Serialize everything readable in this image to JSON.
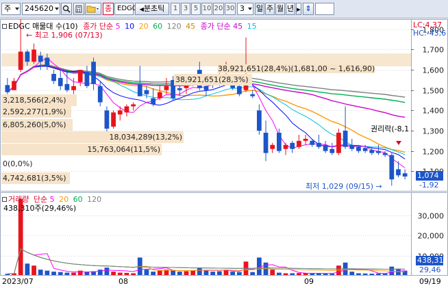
{
  "toolbar": {
    "market_label": "주",
    "code_value": "245620",
    "indicator_label": "EDGC",
    "period_label": "분초틱",
    "period_numbers": [
      "1",
      "3",
      "5",
      "10",
      "20",
      "30"
    ],
    "count_value": "3",
    "day_label": "일",
    "week_label": "주",
    "month_label": "월",
    "year_label": "년"
  },
  "colors": {
    "up": "#e8141c",
    "down": "#1e55c8",
    "ma5": "#ff00ff",
    "ma10": "#0000ff",
    "ma20": "#ff9900",
    "ma60": "#00b050",
    "ma120": "#808080",
    "ma45": "#cc00cc",
    "ma15": "#00c0e0"
  },
  "legend_main": {
    "stock": "EDGC 매물대 수(10)",
    "ma_group1_label": "종가 단순",
    "ma_group1_periods": [
      "5",
      "10",
      "20",
      "60",
      "120",
      "45"
    ],
    "ma_group2_label": "종가 단순",
    "ma_group2_periods": [
      "45",
      "15"
    ]
  },
  "legend_vol": {
    "label": "거래량",
    "ma_label": "단순",
    "periods": [
      "5",
      "20",
      "60",
      "120"
    ],
    "volume_note": "438,310주(29,46%)"
  },
  "price_axis": {
    "ticks": [
      "1,800",
      "1,700",
      "1,600",
      "1,500",
      "1,400",
      "1,300",
      "1,200",
      "1,100"
    ],
    "lc": "LC:4,37",
    "hc": "HC:-43,6",
    "current_price": "1,074",
    "current_change": "-1,92"
  },
  "vol_axis": {
    "ticks": [
      "30,000",
      "20,000",
      "10,000"
    ],
    "current_volume": "438,31",
    "current_change": "29,46"
  },
  "volume_profile": [
    {
      "label": "38,921,651(28,4%)(1,681,00 ~ 1,616,90)"
    },
    {
      "label": "38,921,651(28,3%)"
    },
    {
      "label": "3,218,566(2,4%)"
    },
    {
      "label": "2,592,277(1,9%)"
    },
    {
      "label": "6,805,260(5,0%)"
    },
    {
      "label": "18,034,289(13,2%)"
    },
    {
      "label": "15,763,064(11,5%)"
    },
    {
      "label": "0(0,0%)"
    },
    {
      "label": "4,742,681(3,5%)"
    }
  ],
  "annotations": {
    "high": "최고 1,906 (07/13)",
    "low": "최저 1,029 (09/15)",
    "rights": "권리락(-8,1"
  },
  "dates": [
    "2023/07",
    "08",
    "09",
    "09/19"
  ],
  "chart_data": {
    "type": "candlestick",
    "title": "",
    "ylim": [
      1000,
      1850
    ],
    "candles": [
      {
        "o": 1525,
        "h": 1560,
        "l": 1480,
        "c": 1490
      },
      {
        "o": 1500,
        "h": 1560,
        "l": 1500,
        "c": 1545
      },
      {
        "o": 1600,
        "h": 1906,
        "l": 1590,
        "c": 1690
      },
      {
        "o": 1690,
        "h": 1700,
        "l": 1620,
        "c": 1640
      },
      {
        "o": 1640,
        "h": 1730,
        "l": 1630,
        "c": 1700
      },
      {
        "o": 1670,
        "h": 1690,
        "l": 1600,
        "c": 1640
      },
      {
        "o": 1660,
        "h": 1680,
        "l": 1600,
        "c": 1620
      },
      {
        "o": 1580,
        "h": 1600,
        "l": 1530,
        "c": 1545
      },
      {
        "o": 1560,
        "h": 1600,
        "l": 1500,
        "c": 1520
      },
      {
        "o": 1530,
        "h": 1600,
        "l": 1490,
        "c": 1500
      },
      {
        "o": 1500,
        "h": 1560,
        "l": 1480,
        "c": 1520
      },
      {
        "o": 1540,
        "h": 1600,
        "l": 1520,
        "c": 1600
      },
      {
        "o": 1590,
        "h": 1620,
        "l": 1510,
        "c": 1520
      },
      {
        "o": 1640,
        "h": 1660,
        "l": 1500,
        "c": 1530
      },
      {
        "o": 1520,
        "h": 1540,
        "l": 1420,
        "c": 1440
      },
      {
        "o": 1400,
        "h": 1420,
        "l": 1290,
        "c": 1310
      },
      {
        "o": 1320,
        "h": 1400,
        "l": 1310,
        "c": 1390
      },
      {
        "o": 1380,
        "h": 1420,
        "l": 1350,
        "c": 1400
      },
      {
        "o": 1390,
        "h": 1430,
        "l": 1370,
        "c": 1420
      },
      {
        "o": 1420,
        "h": 1440,
        "l": 1400,
        "c": 1430
      },
      {
        "o": 1530,
        "h": 1620,
        "l": 1470,
        "c": 1470
      },
      {
        "o": 1500,
        "h": 1520,
        "l": 1460,
        "c": 1480
      },
      {
        "o": 1460,
        "h": 1510,
        "l": 1420,
        "c": 1430
      },
      {
        "o": 1460,
        "h": 1520,
        "l": 1450,
        "c": 1490
      },
      {
        "o": 1500,
        "h": 1560,
        "l": 1480,
        "c": 1520
      },
      {
        "o": 1550,
        "h": 1570,
        "l": 1450,
        "c": 1460
      },
      {
        "o": 1510,
        "h": 1540,
        "l": 1470,
        "c": 1500
      },
      {
        "o": 1510,
        "h": 1560,
        "l": 1480,
        "c": 1530
      },
      {
        "o": 1540,
        "h": 1580,
        "l": 1520,
        "c": 1555
      },
      {
        "o": 1600,
        "h": 1640,
        "l": 1500,
        "c": 1510
      },
      {
        "o": 1520,
        "h": 1580,
        "l": 1470,
        "c": 1500
      },
      {
        "o": 1540,
        "h": 1570,
        "l": 1510,
        "c": 1530
      },
      {
        "o": 1560,
        "h": 1600,
        "l": 1520,
        "c": 1545
      },
      {
        "o": 1590,
        "h": 1640,
        "l": 1560,
        "c": 1600
      },
      {
        "o": 1540,
        "h": 1570,
        "l": 1500,
        "c": 1510
      },
      {
        "o": 1520,
        "h": 1530,
        "l": 1470,
        "c": 1480
      },
      {
        "o": 1500,
        "h": 1760,
        "l": 1490,
        "c": 1560
      },
      {
        "o": 1480,
        "h": 1500,
        "l": 1460,
        "c": 1470
      },
      {
        "o": 1400,
        "h": 1430,
        "l": 1280,
        "c": 1300
      },
      {
        "o": 1290,
        "h": 1350,
        "l": 1150,
        "c": 1190
      },
      {
        "o": 1210,
        "h": 1240,
        "l": 1190,
        "c": 1230
      },
      {
        "o": 1290,
        "h": 1310,
        "l": 1190,
        "c": 1200
      },
      {
        "o": 1210,
        "h": 1240,
        "l": 1180,
        "c": 1230
      },
      {
        "o": 1240,
        "h": 1250,
        "l": 1190,
        "c": 1210
      },
      {
        "o": 1220,
        "h": 1280,
        "l": 1210,
        "c": 1250
      },
      {
        "o": 1250,
        "h": 1280,
        "l": 1230,
        "c": 1260
      },
      {
        "o": 1250,
        "h": 1260,
        "l": 1220,
        "c": 1230
      },
      {
        "o": 1240,
        "h": 1280,
        "l": 1210,
        "c": 1220
      },
      {
        "o": 1230,
        "h": 1250,
        "l": 1190,
        "c": 1200
      },
      {
        "o": 1210,
        "h": 1240,
        "l": 1180,
        "c": 1190
      },
      {
        "o": 1190,
        "h": 1310,
        "l": 1180,
        "c": 1290
      },
      {
        "o": 1300,
        "h": 1420,
        "l": 1210,
        "c": 1220
      },
      {
        "o": 1230,
        "h": 1260,
        "l": 1200,
        "c": 1210
      },
      {
        "o": 1220,
        "h": 1230,
        "l": 1190,
        "c": 1200
      },
      {
        "o": 1215,
        "h": 1230,
        "l": 1190,
        "c": 1200
      },
      {
        "o": 1205,
        "h": 1220,
        "l": 1180,
        "c": 1190
      },
      {
        "o": 1200,
        "h": 1230,
        "l": 1180,
        "c": 1190
      },
      {
        "o": 1190,
        "h": 1200,
        "l": 1170,
        "c": 1180
      },
      {
        "o": 1180,
        "h": 1190,
        "l": 1029,
        "c": 1060
      },
      {
        "o": 1110,
        "h": 1150,
        "l": 1070,
        "c": 1080
      },
      {
        "o": 1090,
        "h": 1110,
        "l": 1060,
        "c": 1074
      }
    ],
    "volumes": [
      900,
      1200,
      38000,
      6000,
      5000,
      3000,
      2500,
      2000,
      1800,
      1500,
      1500,
      2500,
      2000,
      2200,
      3000,
      4000,
      2000,
      1500,
      1400,
      1200,
      9000,
      3000,
      2000,
      2500,
      3000,
      2800,
      2000,
      2200,
      2500,
      4000,
      2500,
      2000,
      2200,
      3000,
      2000,
      1800,
      7000,
      1800,
      9000,
      6500,
      3000,
      1500,
      1200,
      1200,
      1300,
      1200,
      1100,
      1100,
      1000,
      1000,
      5000,
      6500,
      2000,
      1200,
      1100,
      1000,
      1100,
      1000,
      4500,
      3500,
      2500
    ]
  }
}
